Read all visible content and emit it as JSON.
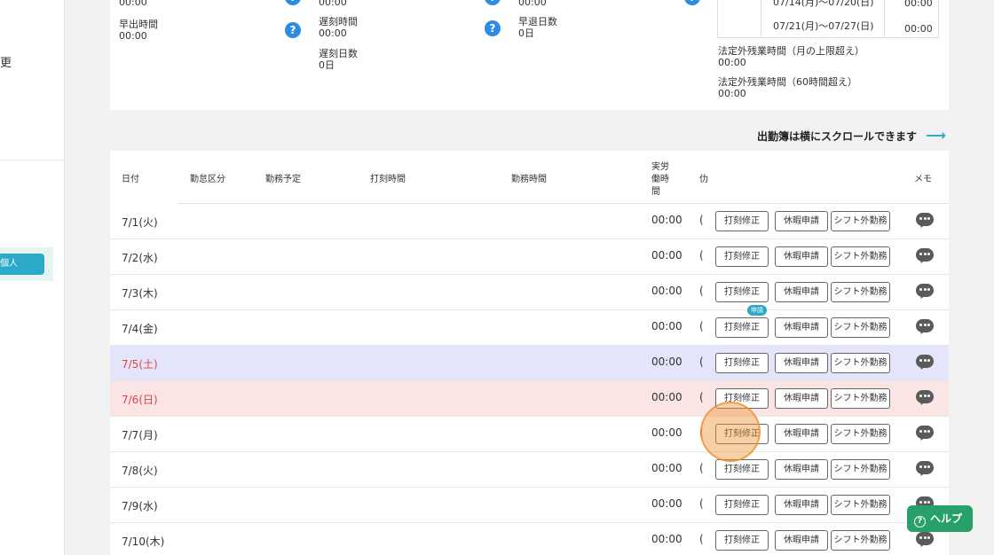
{
  "sidebar": {
    "change_label": "更",
    "personal_label": "個人"
  },
  "summary": {
    "top_values": [
      "00:00",
      "00:00",
      "00:00"
    ],
    "early_leave_time": {
      "label": "早出時間",
      "value": "00:00"
    },
    "late_time": {
      "label": "遅刻時間",
      "value": "00:00"
    },
    "late_days": {
      "label": "遅刻日数",
      "value": "0日"
    },
    "early_leave_days": {
      "label": "早退日数",
      "value": "0日"
    },
    "help_mark": "?",
    "weeks": [
      {
        "label": "07/14(月)～07/20(日)",
        "value": "00:00"
      },
      {
        "label": "07/21(月)～07/27(日)",
        "value": "00:00"
      }
    ],
    "legal_overtime_monthly": {
      "label": "法定外残業時間（月の上限超え）",
      "value": "00:00"
    },
    "legal_overtime_60h": {
      "label": "法定外残業時間（60時間超え）",
      "value": "00:00"
    }
  },
  "scroll_hint": "出勤簿は横にスクロールできます",
  "scroll_arrow": "⟶",
  "table": {
    "headers": {
      "date": "日付",
      "attendance_type": "勤怠区分",
      "scheduled": "勤務予定",
      "clock_time": "打刻時間",
      "work_time": "勤務時間",
      "actual_l1": "実労",
      "actual_l2": "働時",
      "actual_l3": "間",
      "cut": "仂",
      "memo": "メモ"
    },
    "buttons": {
      "punch_fix": "打刻修正",
      "leave_request": "休暇申請",
      "off_shift": "シフト外勤務"
    },
    "pending_badge": "申請",
    "rows": [
      {
        "date": "7/1(火)",
        "time": "00:00",
        "cut": "("
      },
      {
        "date": "7/2(水)",
        "time": "00:00",
        "cut": "("
      },
      {
        "date": "7/3(木)",
        "time": "00:00",
        "cut": "("
      },
      {
        "date": "7/4(金)",
        "time": "00:00",
        "cut": "("
      },
      {
        "date": "7/5(土)",
        "time": "00:00",
        "cut": "("
      },
      {
        "date": "7/6(日)",
        "time": "00:00",
        "cut": "("
      },
      {
        "date": "7/7(月)",
        "time": "00:00",
        "cut": "("
      },
      {
        "date": "7/8(火)",
        "time": "00:00",
        "cut": "("
      },
      {
        "date": "7/9(水)",
        "time": "00:00",
        "cut": "("
      },
      {
        "date": "7/10(木)",
        "time": "00:00",
        "cut": "("
      }
    ]
  },
  "help_button": {
    "label": "ヘルプ",
    "icon": "?"
  },
  "colors": {
    "accent": "#2ca8c8",
    "saturday_bg": "#e4e5fb",
    "sunday_bg": "#fbe4e4",
    "weekend_text": "#e04444",
    "help_bg": "#28a06a"
  }
}
